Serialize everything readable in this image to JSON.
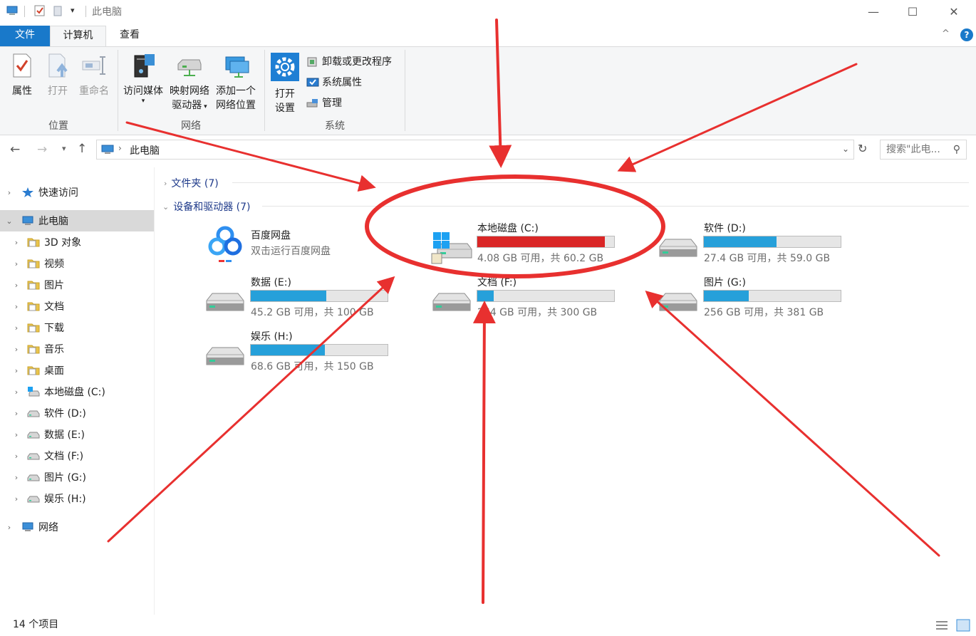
{
  "window": {
    "title": "此电脑",
    "min_glyph": "—",
    "max_glyph": "☐",
    "close_glyph": "✕"
  },
  "ribbon": {
    "tabs": [
      {
        "label": "文件"
      },
      {
        "label": "计算机"
      },
      {
        "label": "查看"
      }
    ],
    "help_glyph": "?",
    "collapse_glyph": "^",
    "groups": {
      "location": {
        "label": "位置",
        "buttons": [
          {
            "label": "属性",
            "icon": "properties-icon"
          },
          {
            "label": "打开",
            "icon": "open-icon"
          },
          {
            "label": "重命名",
            "icon": "rename-icon"
          }
        ]
      },
      "network": {
        "label": "网络",
        "buttons": [
          {
            "label": "访问媒体",
            "icon": "media-icon"
          },
          {
            "label": "映射网络",
            "label2": "驱动器",
            "icon": "map-drive-icon"
          },
          {
            "label": "添加一个",
            "label2": "网络位置",
            "icon": "network-location-icon"
          }
        ]
      },
      "system": {
        "label": "系统",
        "open_settings_1": "打开",
        "open_settings_2": "设置",
        "commands": [
          {
            "label": "卸载或更改程序",
            "icon": "uninstall-icon"
          },
          {
            "label": "系统属性",
            "icon": "system-properties-icon"
          },
          {
            "label": "管理",
            "icon": "manage-icon"
          }
        ]
      }
    }
  },
  "address": {
    "path": "此电脑",
    "search_placeholder": "搜索\"此电..."
  },
  "nav": {
    "items": [
      {
        "label": "快速访问",
        "icon": "star-icon",
        "level": 0
      },
      {
        "label": "此电脑",
        "icon": "pc-icon",
        "level": 0,
        "selected": true
      },
      {
        "label": "3D 对象",
        "icon": "3d-folder-icon",
        "level": 1
      },
      {
        "label": "视频",
        "icon": "video-folder-icon",
        "level": 1
      },
      {
        "label": "图片",
        "icon": "pictures-folder-icon",
        "level": 1
      },
      {
        "label": "文档",
        "icon": "documents-folder-icon",
        "level": 1
      },
      {
        "label": "下载",
        "icon": "downloads-folder-icon",
        "level": 1
      },
      {
        "label": "音乐",
        "icon": "music-folder-icon",
        "level": 1
      },
      {
        "label": "桌面",
        "icon": "desktop-folder-icon",
        "level": 1
      },
      {
        "label": "本地磁盘 (C:)",
        "icon": "system-drive-icon",
        "level": 1
      },
      {
        "label": "软件 (D:)",
        "icon": "drive-icon",
        "level": 1
      },
      {
        "label": "数据 (E:)",
        "icon": "drive-icon",
        "level": 1
      },
      {
        "label": "文档 (F:)",
        "icon": "drive-icon",
        "level": 1
      },
      {
        "label": "图片 (G:)",
        "icon": "drive-icon",
        "level": 1
      },
      {
        "label": "娱乐 (H:)",
        "icon": "drive-icon",
        "level": 1
      },
      {
        "label": "网络",
        "icon": "network-icon",
        "level": 0
      }
    ]
  },
  "content": {
    "folders_header": "文件夹 (7)",
    "devices_header": "设备和驱动器 (7)",
    "baidu": {
      "name": "百度网盘",
      "subtitle": "双击运行百度网盘"
    },
    "drives": [
      {
        "name": "本地磁盘 (C:)",
        "info": "4.08 GB 可用，共 60.2 GB",
        "used_fraction": 0.93,
        "bar_color": "#da2626"
      },
      {
        "name": "软件 (D:)",
        "info": "27.4 GB 可用，共 59.0 GB",
        "used_fraction": 0.53,
        "bar_color": "#26a0da"
      },
      {
        "name": "数据 (E:)",
        "info": "45.2 GB 可用，共 100 GB",
        "used_fraction": 0.55,
        "bar_color": "#26a0da"
      },
      {
        "name": "文档 (F:)",
        "info": "264 GB 可用，共 300 GB",
        "used_fraction": 0.12,
        "bar_color": "#26a0da"
      },
      {
        "name": "图片 (G:)",
        "info": "256 GB 可用，共 381 GB",
        "used_fraction": 0.33,
        "bar_color": "#26a0da"
      },
      {
        "name": "娱乐 (H:)",
        "info": "68.6 GB 可用，共 150 GB",
        "used_fraction": 0.54,
        "bar_color": "#26a0da"
      }
    ]
  },
  "status": {
    "item_count": "14 个项目"
  },
  "annotation": {
    "color": "#e8302f"
  }
}
